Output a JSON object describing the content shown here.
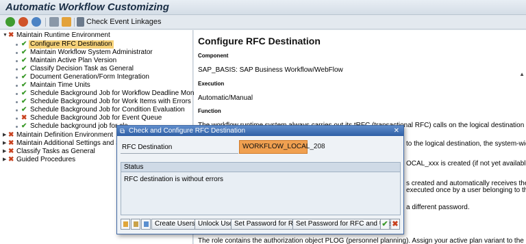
{
  "window": {
    "title": "Automatic Workflow Customizing"
  },
  "toolbar": {
    "check_event_linkages": "Check Event Linkages"
  },
  "tree": {
    "root": "Maintain Runtime Environment",
    "children": [
      "Configure RFC Destination",
      "Maintain Workflow System Administrator",
      "Maintain Active Plan Version",
      "Classify Decision Task as General",
      "Document Generation/Form Integration",
      "Maintain Time Units",
      "Schedule Background Job for Workflow Deadline Monitoring",
      "Schedule Background Job for Work Items with Errors",
      "Schedule Background Job for Condition Evaluation",
      "Schedule Background Job for Event Queue",
      "Schedule background job for cle"
    ],
    "others": [
      "Maintain Definition Environment",
      "Maintain Additional Settings and Serv",
      "Classify Tasks as General",
      "Guided Procedures"
    ]
  },
  "doc": {
    "heading": "Configure RFC Destination",
    "component_label": "Component",
    "component_value": "SAP_BASIS: SAP Business Workflow/WebFlow",
    "execution_label": "Execution",
    "execution_value": "Automatic/Manual",
    "function_label": "Function",
    "line1": "The workflow runtime system always carries out its tRFC (transactional RFC) calls on the logical destination",
    "line2": "to the logical destination, the system-wide",
    "line3": "OCAL_xxx is created (if not yet available).",
    "line4": "s created and automatically receives the",
    "line5": "executed once by a user belonging to the",
    "line6": "a different password.",
    "line7": "The role contains the authorization object PLOG (personnel planning). Assign your active plan variant to the Plan"
  },
  "dialog": {
    "title": "Check and Configure RFC Destination",
    "rfc_label": "RFC Destination",
    "rfc_value": "WORKFLOW_LOCAL_208",
    "status_header": "Status",
    "status_message": "RFC destination is without errors",
    "buttons": {
      "create_users": "Create Users",
      "unlock_user": "Unlock User",
      "set_password": "Set Password for RFC",
      "set_password_user": "Set Password for RFC and User"
    }
  }
}
